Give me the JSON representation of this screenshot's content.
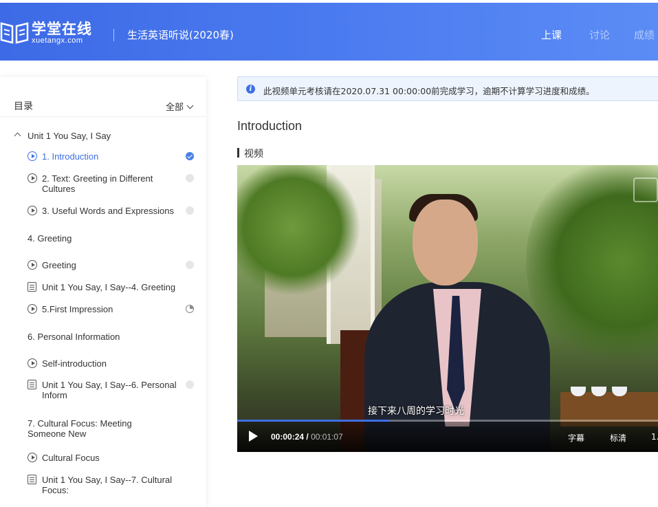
{
  "header": {
    "logo_cn": "学堂在线",
    "logo_en": "xuetangx.com",
    "course_title": "生活英语听说(2020春)",
    "nav": [
      "上课",
      "讨论",
      "成绩"
    ]
  },
  "sidebar": {
    "title": "目录",
    "filter": "全部",
    "items": [
      {
        "type": "unit",
        "label": "Unit 1 You Say, I Say"
      },
      {
        "type": "video",
        "label": "1. Introduction",
        "status": "done",
        "active": true
      },
      {
        "type": "video",
        "label": "2. Text: Greeting in Different Cultures",
        "status": "none"
      },
      {
        "type": "video",
        "label": "3. Useful Words and Expressions",
        "status": "none"
      },
      {
        "type": "chapter",
        "label": "4. Greeting"
      },
      {
        "type": "video",
        "label": "Greeting",
        "status": "none"
      },
      {
        "type": "quiz",
        "label": "Unit 1 You Say, I Say--4. Greeting"
      },
      {
        "type": "video",
        "label": "5.First Impression",
        "status": "partial"
      },
      {
        "type": "chapter",
        "label": "6. Personal Information"
      },
      {
        "type": "video",
        "label": "Self-introduction"
      },
      {
        "type": "quiz",
        "label": "Unit 1 You Say, I Say--6. Personal Inform",
        "status": "none"
      },
      {
        "type": "chapter",
        "label": "7. Cultural Focus: Meeting Someone New"
      },
      {
        "type": "video",
        "label": "Cultural Focus"
      },
      {
        "type": "quiz",
        "label": "Unit 1 You Say, I Say--7. Cultural Focus:"
      }
    ]
  },
  "main": {
    "notice": "此视频单元考核请在2020.07.31 00:00:00前完成学习，逾期不计算学习进度和成绩。",
    "page_title": "Introduction",
    "section_label": "视频"
  },
  "video": {
    "subtitle": "接下来八周的学习时光",
    "current_time": "00:00:24",
    "duration": "00:01:07",
    "progress": 0.358,
    "subtitles_button": "字幕",
    "quality_button": "标清",
    "speed_button": "1."
  },
  "colors": {
    "accent": "#3e6fe3",
    "header_start": "#3d6ae6",
    "header_end": "#5b8cf5"
  }
}
